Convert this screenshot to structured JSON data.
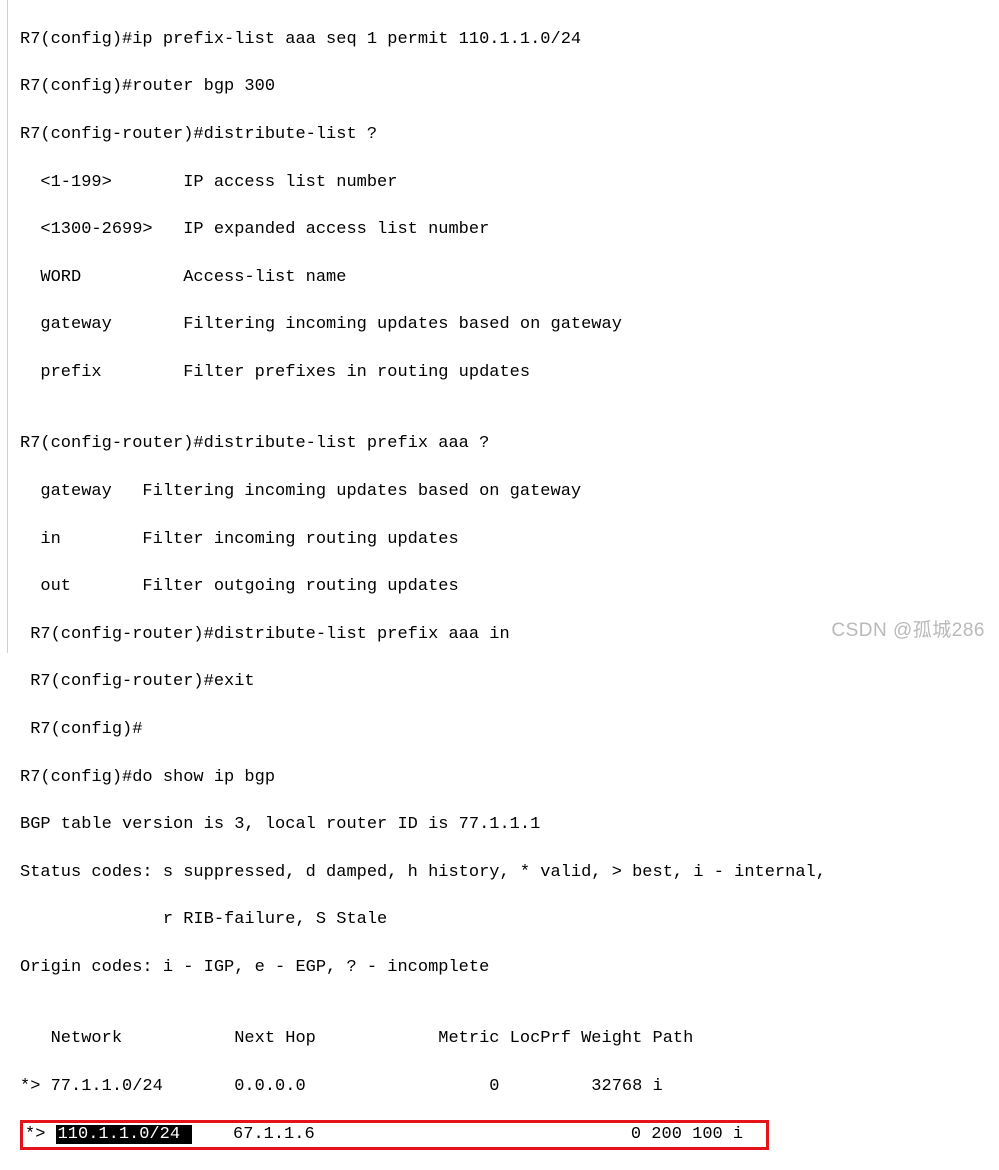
{
  "lines": {
    "l1": "R7(config)#ip prefix-list aaa seq 1 permit 110.1.1.0/24",
    "l2": "R7(config)#router bgp 300",
    "l3": "R7(config-router)#distribute-list ?",
    "l4": "  <1-199>       IP access list number",
    "l5": "  <1300-2699>   IP expanded access list number",
    "l6": "  WORD          Access-list name",
    "l7": "  gateway       Filtering incoming updates based on gateway",
    "l8": "  prefix        Filter prefixes in routing updates",
    "l9": "",
    "l10": "R7(config-router)#distribute-list prefix aaa ?",
    "l11": "  gateway   Filtering incoming updates based on gateway",
    "l12": "  in        Filter incoming routing updates",
    "l13": "  out       Filter outgoing routing updates",
    "l14": " R7(config-router)#distribute-list prefix aaa in",
    "l15": " R7(config-router)#exit",
    "l16": " R7(config)#",
    "l17": "R7(config)#do show ip bgp",
    "l18": "BGP table version is 3, local router ID is 77.1.1.1",
    "l19": "Status codes: s suppressed, d damped, h history, * valid, > best, i - internal,",
    "l20": "              r RIB-failure, S Stale",
    "l21": "Origin codes: i - IGP, e - EGP, ? - incomplete",
    "l22": "",
    "l23": "   Network           Next Hop            Metric LocPrf Weight Path",
    "l24": "*> 77.1.1.0/24       0.0.0.0                  0         32768 i"
  },
  "highlight": {
    "prefix": "*> ",
    "network_inv": "110.1.1.0/24 ",
    "rest": "    67.1.1.6                               0 200 100 i  "
  },
  "watermark": "CSDN @孤城286"
}
